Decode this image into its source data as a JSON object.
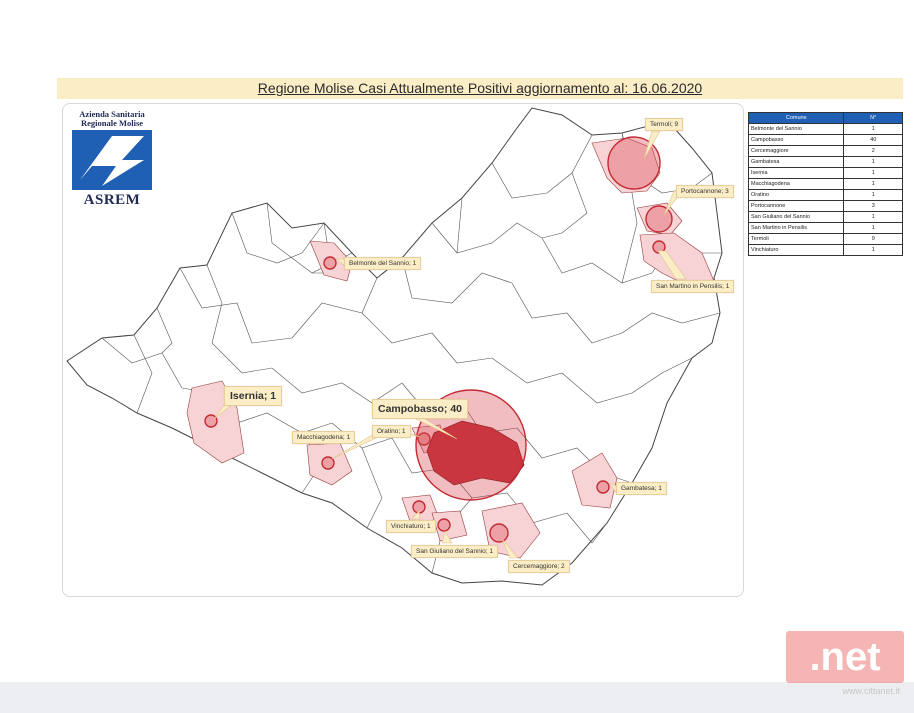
{
  "title": "Regione Molise Casi Attualmente Positivi aggiornamento al: 16.06.2020",
  "logo": {
    "org_line1": "Azienda Sanitaria",
    "org_line2": "Regionale Molise",
    "name": "ASREM"
  },
  "table": {
    "headers": [
      "Comune",
      "N°"
    ],
    "rows": [
      [
        "Belmonte del Sannio",
        "1"
      ],
      [
        "Campobasso",
        "40"
      ],
      [
        "Cercemaggiore",
        "2"
      ],
      [
        "Gambatesa",
        "1"
      ],
      [
        "Isernia",
        "1"
      ],
      [
        "Macchiagodena",
        "1"
      ],
      [
        "Oratino",
        "1"
      ],
      [
        "Portocannone",
        "3"
      ],
      [
        "San Giuliano del Sannio",
        "1"
      ],
      [
        "San Martino in Pensilis",
        "1"
      ],
      [
        "Termoli",
        "9"
      ],
      [
        "Vinchiaturo",
        "1"
      ]
    ]
  },
  "callouts": {
    "termoli": "Termoli; 9",
    "portocannone": "Portocannone; 3",
    "san_martino": "San Martino in Pensilis; 1",
    "belmonte": "Belmonte del Sannio; 1",
    "isernia": "Isernia; 1",
    "campobasso": "Campobasso; 40",
    "macchiagodena": "Macchiagodena; 1",
    "oratino": "Oratino; 1",
    "gambatesa": "Gambatesa; 1",
    "vinchiaturo": "Vinchiaturo; 1",
    "san_giuliano": "San Giuliano del Sannio; 1",
    "cercemaggiore": "Cercemaggiore; 2"
  },
  "colors": {
    "highlight_fill": "#f7d3d6",
    "bubble": "#d9434b",
    "callout_bg": "#fbedc6",
    "table_header": "#1f5fb4"
  },
  "watermark": {
    "text": ".net",
    "url": "www.cittanet.it"
  }
}
